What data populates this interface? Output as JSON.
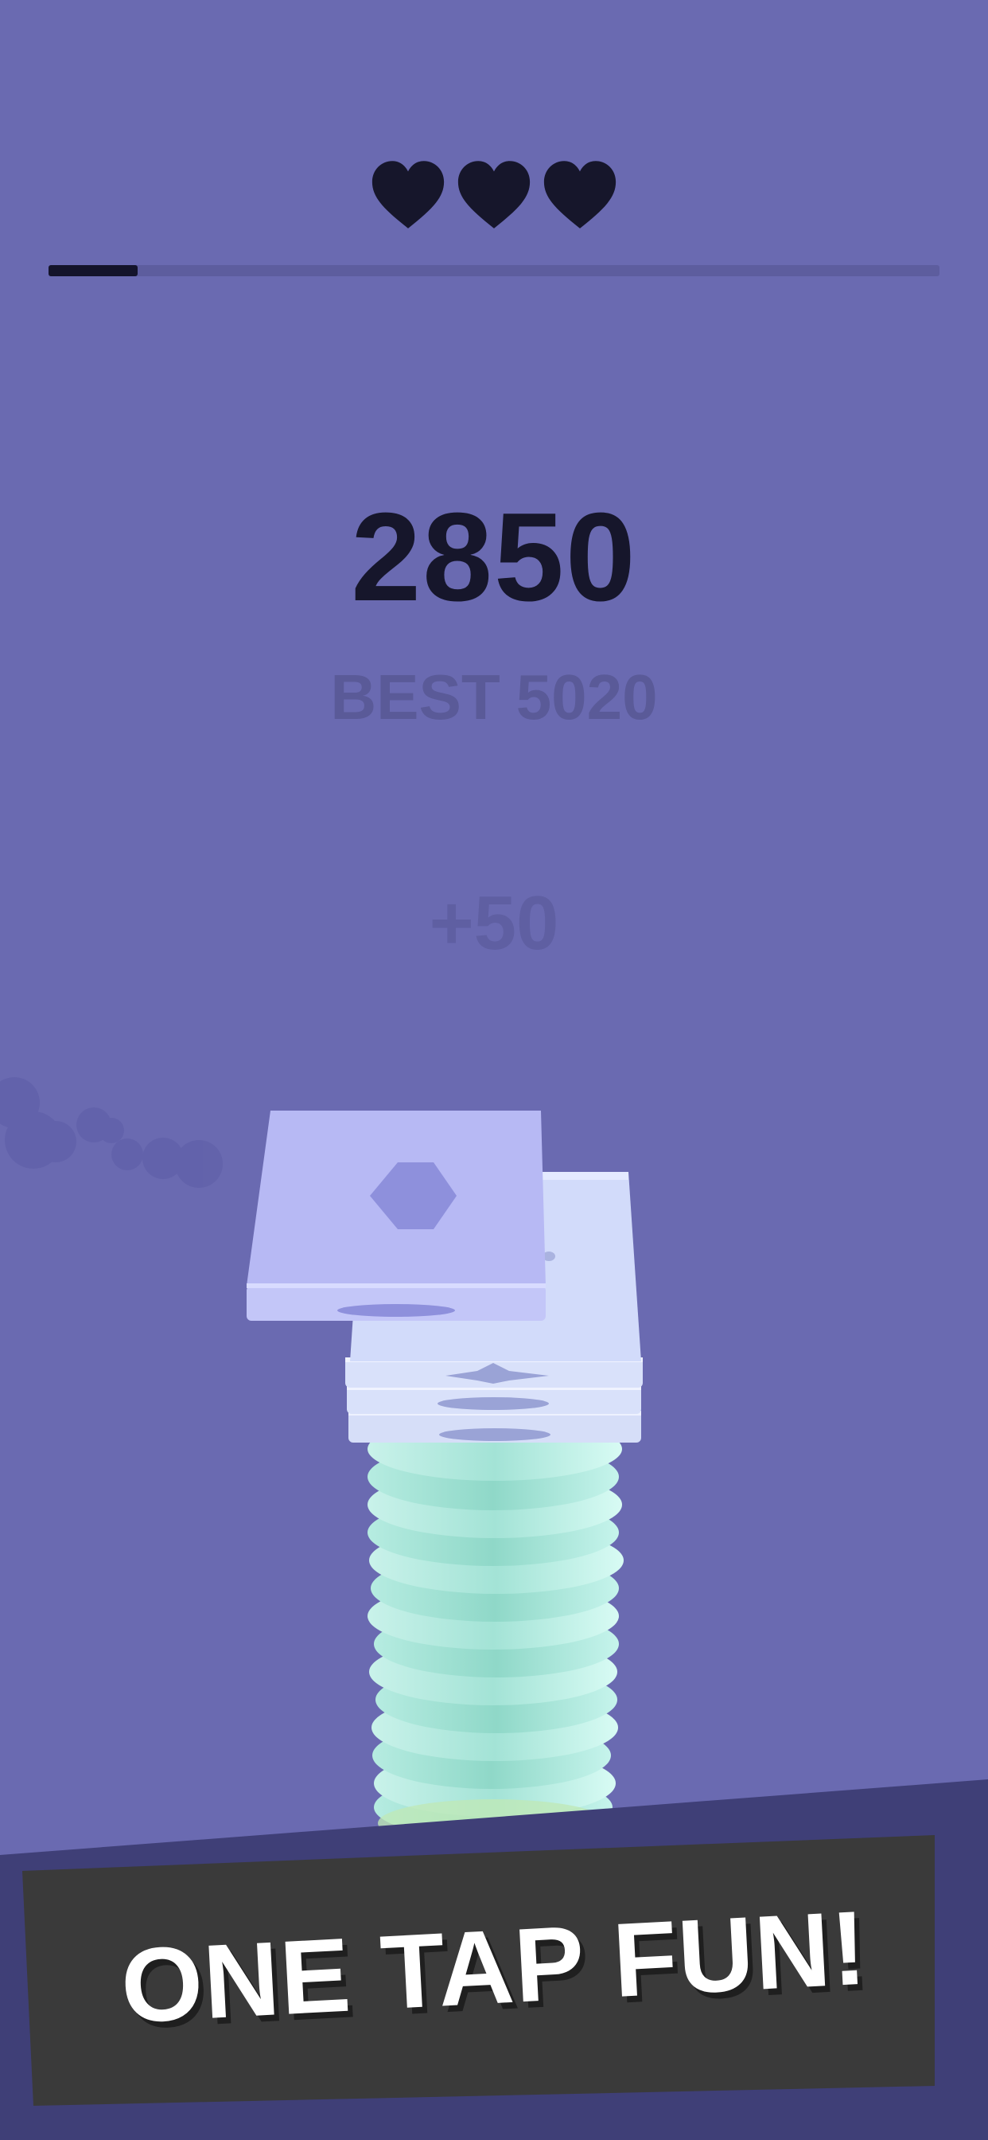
{
  "hud": {
    "lives": 3,
    "level_progress": 0.1
  },
  "score": {
    "current": "2850",
    "best_label": "BEST",
    "best_value": "5020",
    "last_bonus": "+50"
  },
  "banner": {
    "text": "ONE TAP FUN!"
  },
  "colors": {
    "background": "#6a6ab1",
    "heart": "#16162b",
    "banner_band": "#3f3f77",
    "banner_panel": "#3a3a3a"
  },
  "icons": {
    "heart": "heart-icon"
  }
}
